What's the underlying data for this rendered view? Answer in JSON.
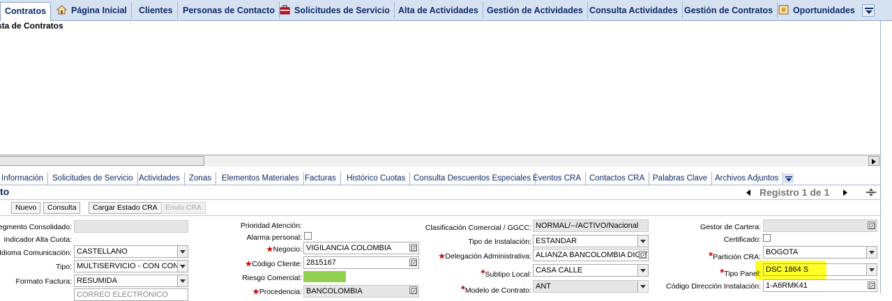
{
  "top_tabs": [
    "Contratos",
    "Página Inicial",
    "Clientes",
    "Personas de Contacto",
    "Solicitudes de Servicio",
    "Alta de Actividades",
    "Gestión de Actividades",
    "Consulta Actividades",
    "Gestión de Contratos",
    "Oportunidades"
  ],
  "list_heading": "sta de Contratos",
  "sub_tabs": [
    "Información",
    "Solicitudes de Servicio",
    "Actividades",
    "Zonas",
    "Elementos Materiales",
    "Facturas",
    "Histórico Cuotas",
    "Consulta Descuentos Especiales",
    "Eventos CRA",
    "Contactos CRA",
    "Palabras Clave",
    "Archivos Adjuntos"
  ],
  "section_title": "to",
  "record_nav": "Registro 1 de 1",
  "buttons": {
    "nuevo": "Nuevo",
    "consulta": "Consulta",
    "cargar": "Cargar Estado CRA",
    "envio": "Envío CRA"
  },
  "form": {
    "segmento": {
      "label": "Segmento Consolidado:",
      "value": ""
    },
    "indicador": {
      "label": "Indicador Alta Cuota:"
    },
    "idioma": {
      "label": "Idioma Comunicación:",
      "value": "CASTELLANO"
    },
    "tipo": {
      "label": "Tipo:",
      "value": "MULTISERVICIO - CON CONEX"
    },
    "formato": {
      "label": "Formato Factura:",
      "value": "RESUMIDA"
    },
    "row5": {
      "value": "CORREO ELECTRÓNICO"
    },
    "prioridad": {
      "label": "Prioridad Atención:"
    },
    "alarma": {
      "label": "Alarma personal:"
    },
    "negocio": {
      "label": "Negocio:",
      "value": "VIGILANCIA COLOMBIA"
    },
    "codigo_cliente": {
      "label": "Código Cliente:",
      "value": "2815167"
    },
    "riesgo": {
      "label": "Riesgo Comercial:"
    },
    "procedencia": {
      "label": "Procedencia:",
      "value": "BANCOLOMBIA"
    },
    "clasificacion": {
      "label": "Clasificación Comercial / GGCC:",
      "value": "NORMAL/--/ACTIVO/Nacional"
    },
    "tipo_instalacion": {
      "label": "Tipo de Instalación:",
      "value": "ESTANDAR"
    },
    "delegacion": {
      "label": "Delegación Administrativa:",
      "value": "ALIANZA BANCOLOMBIA DIGIT"
    },
    "subtipo": {
      "label": "Subtipo Local:",
      "value": "CASA CALLE"
    },
    "modelo": {
      "label": "Modelo de Contrato:",
      "value": "ANT"
    },
    "gestor": {
      "label": "Gestor de Cartera:",
      "value": ""
    },
    "certificado": {
      "label": "Certificado:"
    },
    "particion": {
      "label": "Partición CRA:",
      "value": "BOGOTA"
    },
    "tipo_panel": {
      "label": "Tipo Panel:",
      "value": "DSC 1864 S"
    },
    "codigo_dir": {
      "label": "Código Dirección Instalación:",
      "value": "1-A6RMK41"
    }
  },
  "colors": {
    "tab_bg": "#d6e2f2",
    "tab_text": "#0b2a6a",
    "required": "#cc0000",
    "risk": "#92d050",
    "highlight": "#ffff00"
  }
}
